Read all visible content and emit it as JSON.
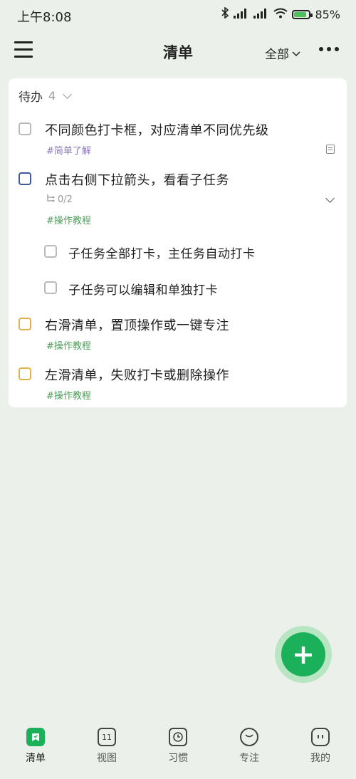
{
  "status": {
    "time": "上午8:08",
    "battery": "85%",
    "battery_level": 0.85
  },
  "header": {
    "title": "清单",
    "filter_label": "全部"
  },
  "section": {
    "label": "待办",
    "count": "4"
  },
  "tasks": [
    {
      "title": "不同颜色打卡框，对应清单不同优先级",
      "tag": "#简单了解",
      "checkbox_color": "#b9b9b9"
    },
    {
      "title": "点击右侧下拉箭头，看看子任务",
      "subtask_count": "0/2",
      "tag": "#操作教程",
      "checkbox_color": "#3d5a9a",
      "subtasks": [
        {
          "title": "子任务全部打卡，主任务自动打卡"
        },
        {
          "title": "子任务可以编辑和单独打卡"
        }
      ]
    },
    {
      "title": "右滑清单，置顶操作或一键专注",
      "tag": "#操作教程",
      "checkbox_color": "#e0b24a"
    },
    {
      "title": "左滑清单，失败打卡或删除操作",
      "tag": "#操作教程",
      "checkbox_color": "#e0b24a"
    }
  ],
  "fab": {
    "symbol": "+"
  },
  "nav": {
    "items": [
      {
        "label": "清单",
        "icon": "list-icon",
        "active": true
      },
      {
        "label": "视图",
        "icon": "calendar-icon",
        "calendar_day": "11"
      },
      {
        "label": "习惯",
        "icon": "clock-icon"
      },
      {
        "label": "专注",
        "icon": "tomato-icon"
      },
      {
        "label": "我的",
        "icon": "profile-icon"
      }
    ]
  },
  "colors": {
    "accent": "#1bb05a",
    "background": "#ebf1ea",
    "tag_purple": "#8a78b8",
    "tag_green": "#4f9e5a"
  }
}
